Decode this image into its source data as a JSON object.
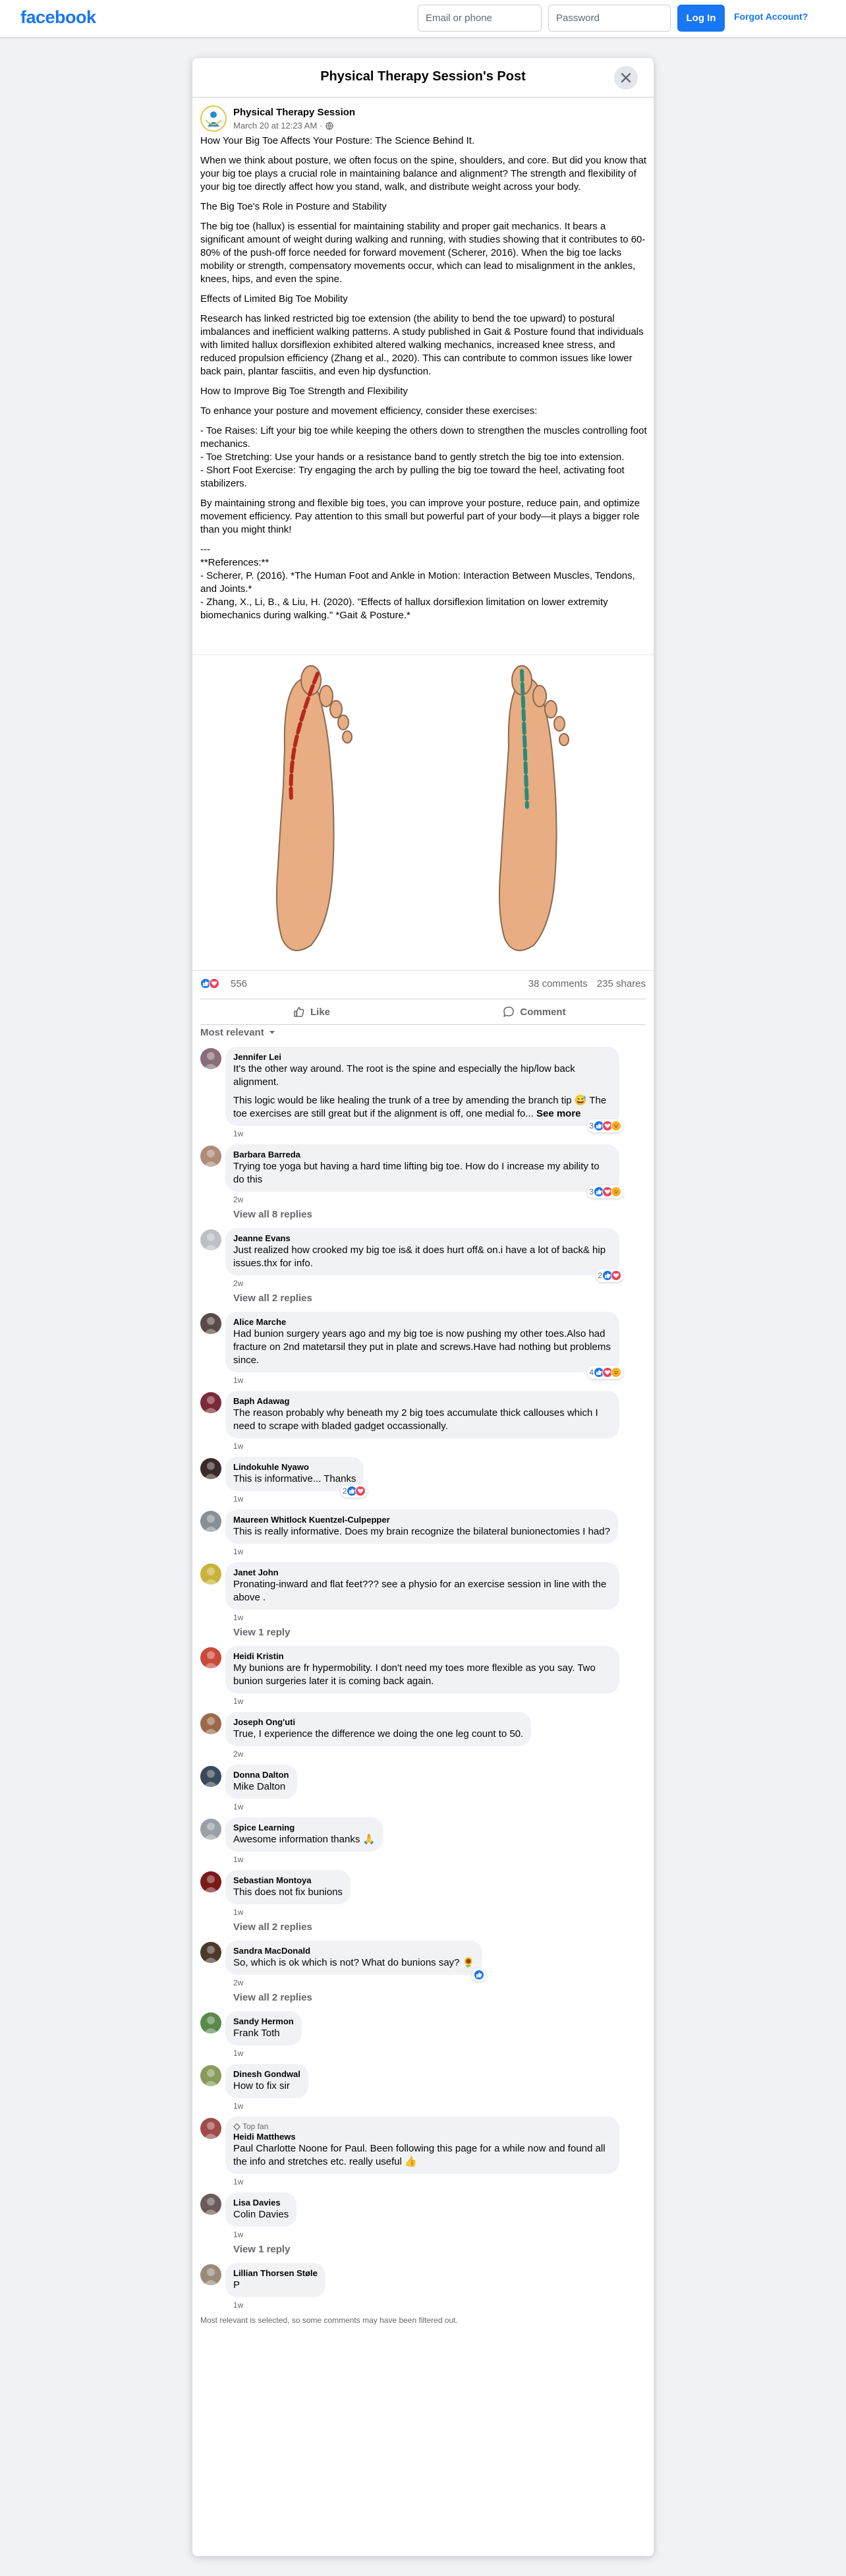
{
  "topbar": {
    "logo": "facebook",
    "email_placeholder": "Email or phone",
    "password_placeholder": "Password",
    "login_label": "Log In",
    "forgot_label": "Forgot Account?"
  },
  "post": {
    "dialog_title": "Physical Therapy Session's Post",
    "author": "Physical Therapy Session",
    "timestamp": "March 20 at 12:23 AM",
    "paragraphs": [
      "How Your Big Toe Affects Your Posture: The Science Behind It.",
      "When we think about posture, we often focus on the spine, shoulders, and core. But did you know that your big toe plays a crucial role in maintaining balance and alignment? The strength and flexibility of your big toe directly affect how you stand, walk, and distribute weight across your body.",
      "The Big Toe's Role in Posture and Stability",
      "The big toe (hallux) is essential for maintaining stability and proper gait mechanics. It bears a significant amount of weight during walking and running, with studies showing that it contributes to 60-80% of the push-off force needed for forward movement (Scherer, 2016). When the big toe lacks mobility or strength, compensatory movements occur, which can lead to misalignment in the ankles, knees, hips, and even the spine.",
      "Effects of Limited Big Toe Mobility",
      "Research has linked restricted big toe extension (the ability to bend the toe upward) to postural imbalances and inefficient walking patterns. A study published in Gait & Posture found that individuals with limited hallux dorsiflexion exhibited altered walking mechanics, increased knee stress, and reduced propulsion efficiency (Zhang et al., 2020). This can contribute to common issues like lower back pain, plantar fasciitis, and even hip dysfunction.",
      "How to Improve Big Toe Strength and Flexibility",
      "To enhance your posture and movement efficiency, consider these exercises:",
      "- Toe Raises: Lift your big toe while keeping the others down to strengthen the muscles controlling foot mechanics.\n- Toe Stretching: Use your hands or a resistance band to gently stretch the big toe into extension.\n- Short Foot Exercise: Try engaging the arch by pulling the big toe toward the heel, activating foot stabilizers.",
      "By maintaining strong and flexible big toes, you can improve your posture, reduce pain, and optimize movement efficiency. Pay attention to this small but powerful part of your body—it plays a bigger role than you might think!",
      "---\n**References:**\n- Scherer, P. (2016). *The Human Foot and Ankle in Motion: Interaction Between Muscles, Tendons, and Joints.*\n- Zhang, X., Li, B., & Liu, H. (2020). \"Effects of hallux dorsiflexion limitation on lower extremity biomechanics during walking.\" *Gait & Posture.*"
    ],
    "reaction_count": "556",
    "comments_count": "38 comments",
    "shares_count": "235 shares",
    "like_label": "Like",
    "comment_label": "Comment",
    "sort_label": "Most relevant"
  },
  "comments": [
    {
      "name": "Jennifer Lei",
      "texts": [
        "It's the other way around. The root is the spine and especially the hip/low back alignment.",
        "This logic would be like healing the trunk of a tree by amending the branch tip 😅 The toe exercises are still great but if the alignment is off, one medial fo... "
      ],
      "see_more": "See more",
      "time": "1w",
      "reacts": "3",
      "avatar_color": "#8a6d7a"
    },
    {
      "name": "Barbara Barreda",
      "texts": [
        "Trying toe yoga but having a hard time lifting big toe. How do I increase my ability to do this"
      ],
      "time": "2w",
      "reacts": "3",
      "avatar_color": "#b08b78",
      "replies": "View all 8 replies"
    },
    {
      "name": "Jeanne Evans",
      "texts": [
        "Just realized how crooked my big toe is& it does hurt off& on.i have a lot of back& hip issues.thx for info."
      ],
      "time": "2w",
      "reacts": "2",
      "avatar_color": "#bcc0c4",
      "replies": "View all 2 replies"
    },
    {
      "name": "Alice Marche",
      "texts": [
        "Had bunion surgery years ago and my big toe is now pushing my other toes.Also had fracture on 2nd matetarsil they put in plate and screws.Have had nothing but problems since."
      ],
      "time": "1w",
      "reacts": "4",
      "avatar_color": "#5a4a4a"
    },
    {
      "name": "Baph Adawag",
      "texts": [
        "The reason probably why beneath my 2 big toes accumulate thick callouses which I need to scrape with bladed gadget occassionally."
      ],
      "time": "1w",
      "avatar_color": "#7a2a3a"
    },
    {
      "name": "Lindokuhle Nyawo",
      "texts": [
        "This is informative... Thanks"
      ],
      "time": "1w",
      "reacts": "2",
      "avatar_color": "#3a2a2a"
    },
    {
      "name": "Maureen Whitlock Kuentzel-Culpepper",
      "texts": [
        "This is really informative. Does my brain recognize the bilateral bunionectomies I had?"
      ],
      "time": "1w",
      "avatar_color": "#8a8f94"
    },
    {
      "name": "Janet John",
      "texts": [
        "Pronating-inward and flat feet??? see a physio for an exercise session in line with the above ."
      ],
      "time": "1w",
      "avatar_color": "#c9b23a",
      "replies": "View 1 reply"
    },
    {
      "name": "Heidi Kristin",
      "texts": [
        "My bunions are fr hypermobility. I don't need my toes more flexible as you say. Two bunion surgeries later it is coming back again."
      ],
      "time": "1w",
      "avatar_color": "#c94a3a"
    },
    {
      "name": "Joseph Ong'uti",
      "texts": [
        "True, I experience the difference we doing the one leg count to 50."
      ],
      "time": "2w",
      "avatar_color": "#9a6a4a"
    },
    {
      "name": "Donna Dalton",
      "texts": [
        "Mike Dalton"
      ],
      "time": "1w",
      "avatar_color": "#3a4a5a"
    },
    {
      "name": "Spice Learning",
      "texts": [
        "Awesome information thanks 🙏"
      ],
      "time": "1w",
      "avatar_color": "#9aa0a6"
    },
    {
      "name": "Sebastian Montoya",
      "texts": [
        "This does not fix bunions"
      ],
      "time": "1w",
      "avatar_color": "#7a1a1a",
      "replies": "View all 2 replies"
    },
    {
      "name": "Sandra MacDonald",
      "texts": [
        "So, which is ok which is not? What do bunions say? 🌻"
      ],
      "time": "2w",
      "reacts": "",
      "avatar_color": "#4a3a2a",
      "replies": "View all 2 replies"
    },
    {
      "name": "Sandy Hermon",
      "texts": [
        "Frank Toth"
      ],
      "time": "1w",
      "avatar_color": "#5a8a4a"
    },
    {
      "name": "Dinesh Gondwal",
      "texts": [
        "How to fix sir"
      ],
      "time": "1w",
      "avatar_color": "#8a9a5a"
    },
    {
      "name": "Heidi Matthews",
      "badge": "Top fan",
      "texts": [
        "Paul Charlotte Noone for Paul. Been following this page for a while now and found all the info and stretches etc. really useful 👍"
      ],
      "time": "1w",
      "avatar_color": "#a04a4a"
    },
    {
      "name": "Lisa Davies",
      "texts": [
        "Colin Davies"
      ],
      "time": "1w",
      "avatar_color": "#6a5a5a",
      "replies": "View 1 reply"
    },
    {
      "name": "Lillian Thorsen Støle",
      "texts": [
        "P"
      ],
      "time": "1w",
      "avatar_color": "#9a8a7a"
    }
  ],
  "footer_note": "Most relevant is selected, so some comments may have been filtered out.",
  "colors": {
    "brand": "#1877f2",
    "bg": "#f0f2f5",
    "muted": "#65676b",
    "line_red": "#b22a1e",
    "line_teal": "#2a8a7a",
    "skin": "#e8ad82"
  }
}
